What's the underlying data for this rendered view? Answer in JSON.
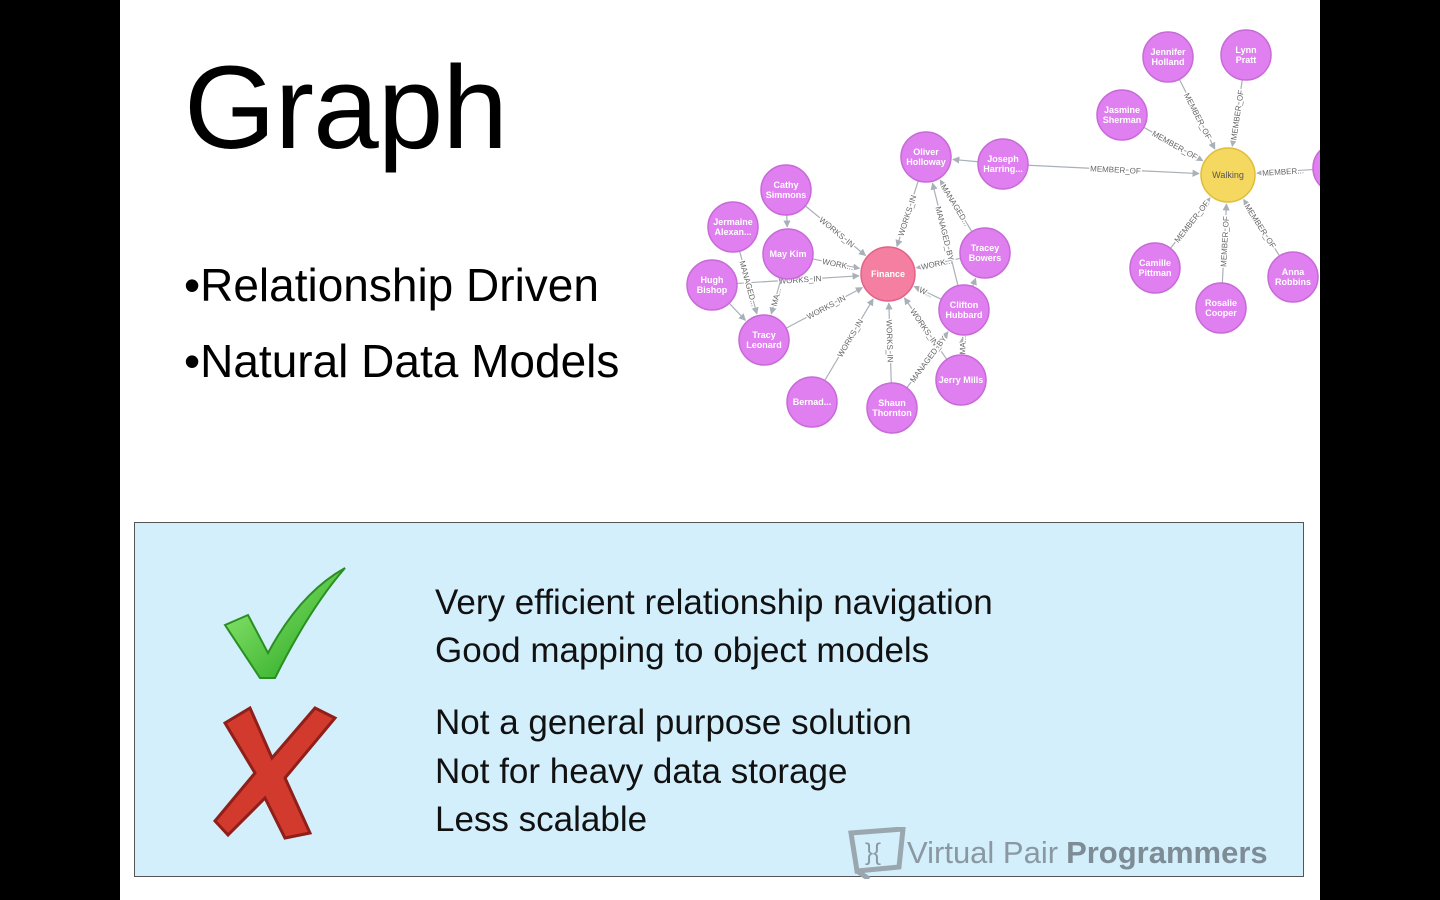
{
  "slide": {
    "title": "Graph",
    "bullets": [
      "•Relationship Driven",
      "•Natural Data Models"
    ]
  },
  "pros": [
    "Very efficient relationship navigation",
    "Good mapping to object models"
  ],
  "cons": [
    "Not a general purpose solution",
    "Not for heavy data storage",
    "Less scalable"
  ],
  "logo": {
    "light": "Virtual Pair",
    "bold": "Programmers"
  },
  "colors": {
    "person": "#e07ff0",
    "department": "#f47fa0",
    "group": "#f5d860",
    "box": "#d3effc"
  },
  "graph": {
    "nodes": [
      {
        "label": [
          "Finance"
        ],
        "kind": "department"
      },
      {
        "label": [
          "Oliver",
          "Holloway"
        ],
        "kind": "person"
      },
      {
        "label": [
          "Joseph",
          "Harring..."
        ],
        "kind": "person"
      },
      {
        "label": [
          "Cathy",
          "Simmons"
        ],
        "kind": "person"
      },
      {
        "label": [
          "Jermaine",
          "Alexan..."
        ],
        "kind": "person"
      },
      {
        "label": [
          "May Kim"
        ],
        "kind": "person"
      },
      {
        "label": [
          "Hugh",
          "Bishop"
        ],
        "kind": "person"
      },
      {
        "label": [
          "Tracy",
          "Leonard"
        ],
        "kind": "person"
      },
      {
        "label": [
          "Bernad..."
        ],
        "kind": "person"
      },
      {
        "label": [
          "Shaun",
          "Thornton"
        ],
        "kind": "person"
      },
      {
        "label": [
          "Jerry Mills"
        ],
        "kind": "person"
      },
      {
        "label": [
          "Clifton",
          "Hubbard"
        ],
        "kind": "person"
      },
      {
        "label": [
          "Tracey",
          "Bowers"
        ],
        "kind": "person"
      },
      {
        "label": [
          "Walking"
        ],
        "kind": "group"
      },
      {
        "label": [
          "Jennifer",
          "Holland"
        ],
        "kind": "person"
      },
      {
        "label": [
          "Lynn",
          "Pratt"
        ],
        "kind": "person"
      },
      {
        "label": [
          "Jasmine",
          "Sherman"
        ],
        "kind": "person"
      },
      {
        "label": [
          "Camille",
          "Pittman"
        ],
        "kind": "person"
      },
      {
        "label": [
          "Rosalie",
          "Cooper"
        ],
        "kind": "person"
      },
      {
        "label": [
          "Anna",
          "Robbins"
        ],
        "kind": "person"
      },
      {
        "label": [
          ""
        ],
        "kind": "person"
      }
    ],
    "edges": [
      {
        "from": 1,
        "to": 0,
        "label": "WORKS_IN"
      },
      {
        "from": 2,
        "to": 1,
        "label": ""
      },
      {
        "from": 3,
        "to": 0,
        "label": "WORKS_IN"
      },
      {
        "from": 5,
        "to": 0,
        "label": "WORK..."
      },
      {
        "from": 6,
        "to": 0,
        "label": "WORKS_IN"
      },
      {
        "from": 7,
        "to": 0,
        "label": "WORKS_IN"
      },
      {
        "from": 8,
        "to": 0,
        "label": "WORKS_IN"
      },
      {
        "from": 9,
        "to": 0,
        "label": "WORKS_IN"
      },
      {
        "from": 10,
        "to": 0,
        "label": "WORKS_IN"
      },
      {
        "from": 11,
        "to": 0,
        "label": "W..."
      },
      {
        "from": 12,
        "to": 0,
        "label": "WORK..."
      },
      {
        "from": 4,
        "to": 7,
        "label": "MANAGED..."
      },
      {
        "from": 5,
        "to": 7,
        "label": "MA..."
      },
      {
        "from": 6,
        "to": 7,
        "label": ""
      },
      {
        "from": 3,
        "to": 5,
        "label": ""
      },
      {
        "from": 11,
        "to": 1,
        "label": "MANAGED_BY"
      },
      {
        "from": 12,
        "to": 1,
        "label": "MANAGED..."
      },
      {
        "from": 10,
        "to": 11,
        "label": "MA..."
      },
      {
        "from": 9,
        "to": 11,
        "label": "MANAGED_BY"
      },
      {
        "from": 11,
        "to": 12,
        "label": ""
      },
      {
        "from": 2,
        "to": 13,
        "label": "MEMBER_OF"
      },
      {
        "from": 14,
        "to": 13,
        "label": "MEMBER_OF"
      },
      {
        "from": 15,
        "to": 13,
        "label": "MEMBER_OF"
      },
      {
        "from": 16,
        "to": 13,
        "label": "MEMBER_OF"
      },
      {
        "from": 17,
        "to": 13,
        "label": "MEMBER_OF"
      },
      {
        "from": 18,
        "to": 13,
        "label": "MEMBER_OF"
      },
      {
        "from": 19,
        "to": 13,
        "label": "MEMBER_OF"
      },
      {
        "from": 20,
        "to": 13,
        "label": "MEMBER..."
      }
    ]
  }
}
